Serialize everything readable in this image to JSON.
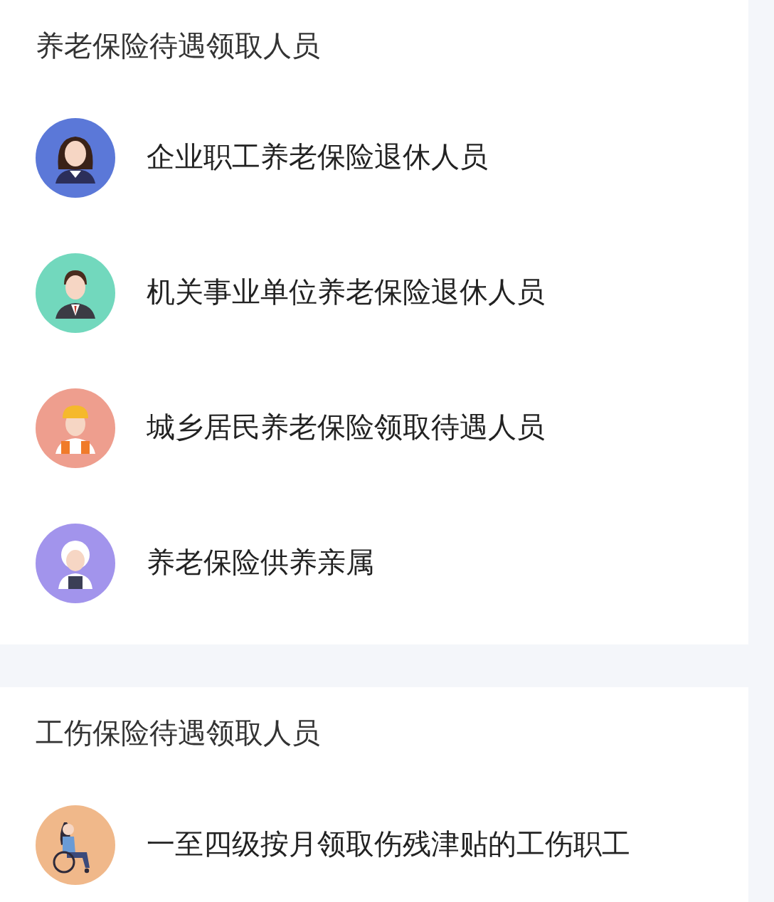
{
  "sections": [
    {
      "title": "养老保险待遇领取人员",
      "items": [
        {
          "label": "企业职工养老保险退休人员",
          "kind": "woman",
          "color": "#5b78d8"
        },
        {
          "label": "机关事业单位养老保险退休人员",
          "kind": "man",
          "color": "#72d8bd"
        },
        {
          "label": "城乡居民养老保险领取待遇人员",
          "kind": "worker",
          "color": "#ee9e8e"
        },
        {
          "label": "养老保险供养亲属",
          "kind": "elder",
          "color": "#a294ec"
        }
      ]
    },
    {
      "title": "工伤保险待遇领取人员",
      "items": [
        {
          "label": "一至四级按月领取伤残津贴的工伤职工",
          "kind": "wheelchair",
          "color": "#f0b88a"
        }
      ]
    }
  ]
}
